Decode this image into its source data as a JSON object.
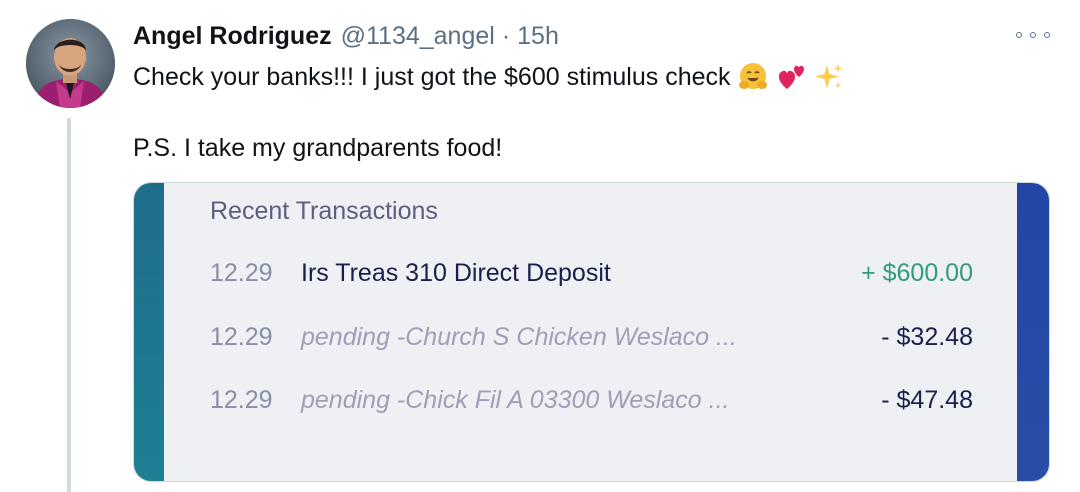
{
  "tweet": {
    "author": {
      "name": "Angel Rodriguez",
      "handle": "@1134_angel",
      "separator": "·",
      "time": "15h"
    },
    "text_line1": "Check your banks!!! I just got the $600 stimulus check",
    "emojis": [
      "hugging-face-emoji",
      "two-hearts-emoji",
      "sparkles-emoji"
    ],
    "text_line2": "P.S. I take my grandparents food!",
    "more_icon": "more-horizontal-icon"
  },
  "card": {
    "title": "Recent Transactions",
    "transactions": [
      {
        "date": "12.29",
        "description": "Irs Treas 310 Direct Deposit",
        "amount": "+ $600.00",
        "pending": false
      },
      {
        "date": "12.29",
        "description": "pending -Church S Chicken Weslaco ...",
        "amount": "- $32.48",
        "pending": true
      },
      {
        "date": "12.29",
        "description": "pending -Chick Fil A 03300 Weslaco ...",
        "amount": "- $47.48",
        "pending": true
      }
    ]
  },
  "colors": {
    "name": "#0f1419",
    "secondary_text": "#5b7083",
    "credit_amount": "#2f9d79",
    "debit_amount": "#1a1f4b",
    "card_background": "#eef0f4",
    "card_left_bar": "#1f6d8c",
    "card_right_bar": "#2146a5",
    "thread_line": "#cfd9de"
  }
}
